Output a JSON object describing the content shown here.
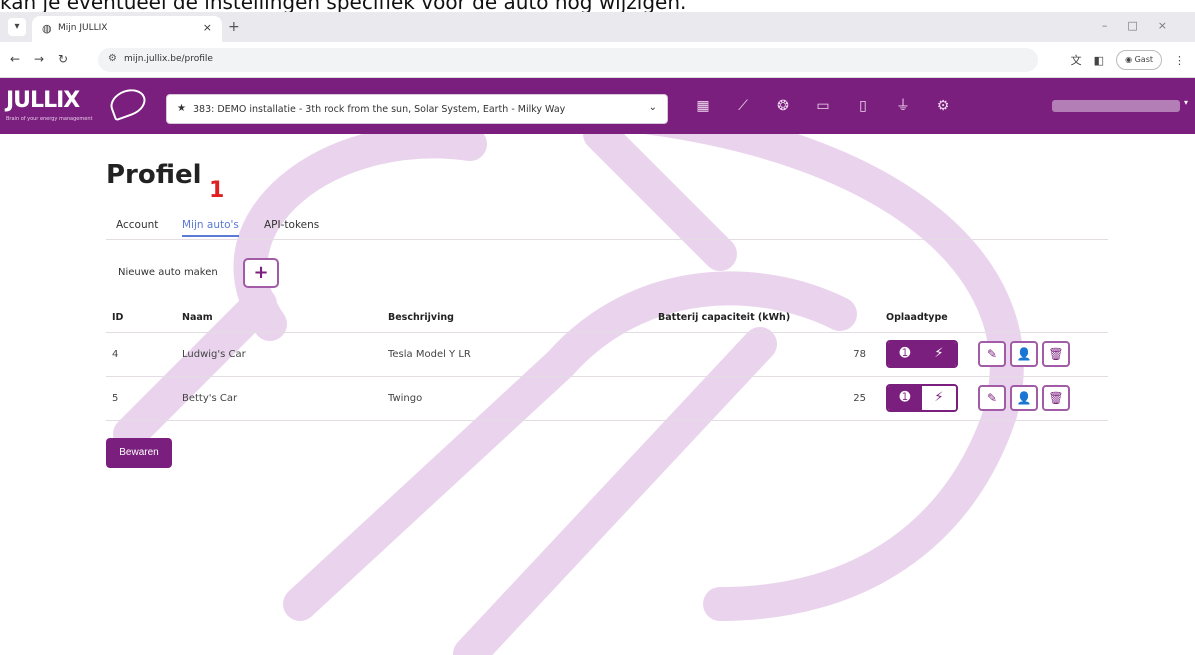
{
  "caption": "kan je eventueel de instellingen specifiek voor de auto nog wijzigen.",
  "browser": {
    "tab_title": "Mijn JULLIX",
    "url": "mijn.jullix.be/profile",
    "guest_label": "Gast"
  },
  "app": {
    "logo": "JULLIX",
    "logo_tagline": "Brain of your energy management",
    "installation": "383: DEMO installatie - 3th rock from the sun, Solar System, Earth - Milky Way",
    "nav_icons": [
      "dashboard-icon",
      "chart-icon",
      "brain-icon",
      "battery-icon",
      "phone-charge-icon",
      "plug-icon",
      "gear-icon"
    ]
  },
  "page": {
    "title": "Profiel",
    "step_marker": "1",
    "tabs": [
      "Account",
      "Mijn auto's",
      "API-tokens"
    ],
    "active_tab": "Mijn auto's",
    "new_car_label": "Nieuwe auto maken",
    "add_button": "+",
    "save_button": "Bewaren"
  },
  "table": {
    "headers": [
      "ID",
      "Naam",
      "Beschrijving",
      "Batterij capaciteit (kWh)",
      "Oplaadtype"
    ],
    "rows": [
      {
        "id": "4",
        "name": "Ludwig's Car",
        "description": "Tesla Model Y LR",
        "capacity": "78",
        "charge_type": "smart"
      },
      {
        "id": "5",
        "name": "Betty's Car",
        "description": "Twingo",
        "capacity": "25",
        "charge_type": "standard"
      }
    ]
  },
  "colors": {
    "brand": "#7a1f7e",
    "active_tab": "#5a7bd6",
    "watermark": "#ead3ec",
    "step_marker": "#e02020"
  }
}
